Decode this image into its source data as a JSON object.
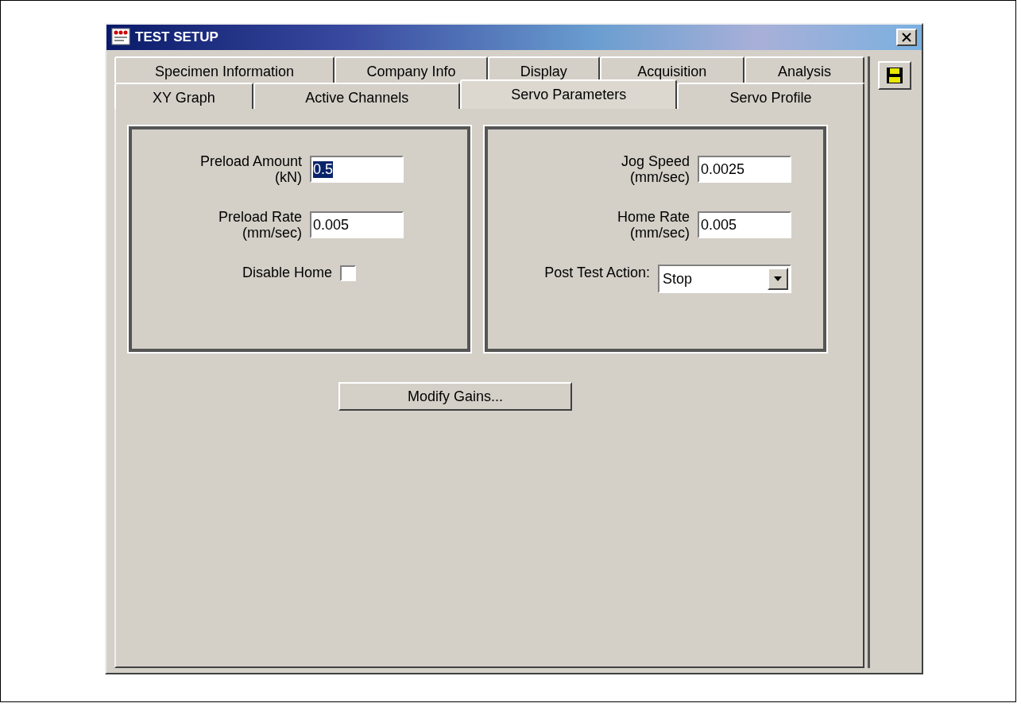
{
  "window": {
    "title": "TEST SETUP"
  },
  "tab_rows": [
    [
      {
        "label": "Specimen Information",
        "selected": false
      },
      {
        "label": "Company Info",
        "selected": false
      },
      {
        "label": "Display",
        "selected": false
      },
      {
        "label": "Acquisition",
        "selected": false
      },
      {
        "label": "Analysis",
        "selected": false
      }
    ],
    [
      {
        "label": "XY Graph",
        "selected": false
      },
      {
        "label": "Active Channels",
        "selected": false
      },
      {
        "label": "Servo Parameters",
        "selected": true
      },
      {
        "label": "Servo Profile",
        "selected": false
      }
    ]
  ],
  "panels": [
    {
      "fields": [
        {
          "kind": "text",
          "label": "Preload Amount",
          "unit": "(kN)",
          "value": "0.5",
          "highlighted": true
        },
        {
          "kind": "text",
          "label": "Preload Rate",
          "unit": "(mm/sec)",
          "value": "0.005",
          "highlighted": false
        },
        {
          "kind": "checkbox",
          "label": "Disable Home",
          "checked": false
        }
      ]
    },
    {
      "fields": [
        {
          "kind": "text",
          "label": "Jog Speed",
          "unit": "(mm/sec)",
          "value": "0.0025",
          "highlighted": false
        },
        {
          "kind": "text",
          "label": "Home Rate",
          "unit": "(mm/sec)",
          "value": "0.005",
          "highlighted": false
        },
        {
          "kind": "dropdown",
          "label": "Post Test Action:",
          "value": "Stop"
        }
      ]
    }
  ],
  "button": "Modify Gains..."
}
